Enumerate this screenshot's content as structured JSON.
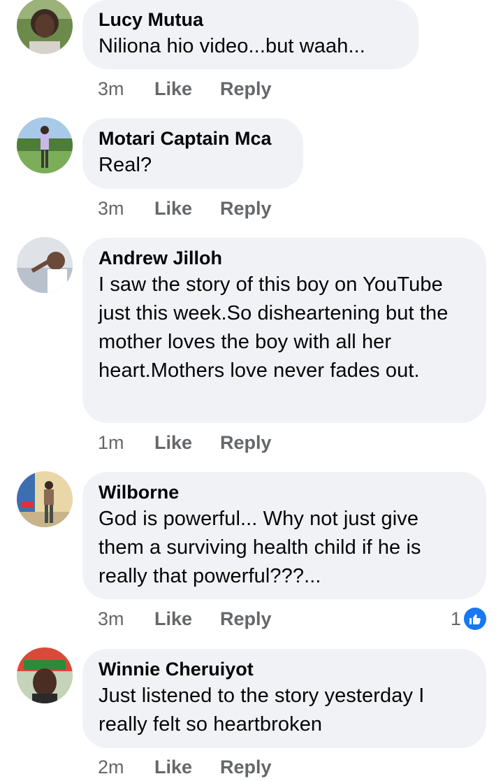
{
  "comments": [
    {
      "author": "Lucy Mutua",
      "text": "Niliona hio video...but waah...",
      "time": "3m",
      "like_label": "Like",
      "reply_label": "Reply"
    },
    {
      "author": "Motari Captain Mca",
      "text": "Real?",
      "time": "3m",
      "like_label": "Like",
      "reply_label": "Reply"
    },
    {
      "author": "Andrew Jilloh",
      "text": "I saw the story of this boy on YouTube just this week.So disheartening but the mother loves the boy with all her heart.Mothers love never fades out.",
      "time": "1m",
      "like_label": "Like",
      "reply_label": "Reply"
    },
    {
      "author": "Wilborne",
      "text": "God is powerful... Why not just give them a surviving health child if he is really that powerful???...",
      "time": "3m",
      "like_label": "Like",
      "reply_label": "Reply",
      "reaction_count": "1",
      "reaction_icon": "thumbs-up-icon"
    },
    {
      "author": "Winnie Cheruiyot",
      "text": "Just listened to the story yesterday I really felt so heartbroken",
      "time": "2m",
      "like_label": "Like",
      "reply_label": "Reply"
    }
  ],
  "colors": {
    "bubble": "#f0f2f5",
    "meta": "#65676b",
    "like_badge": "#1877f2"
  }
}
